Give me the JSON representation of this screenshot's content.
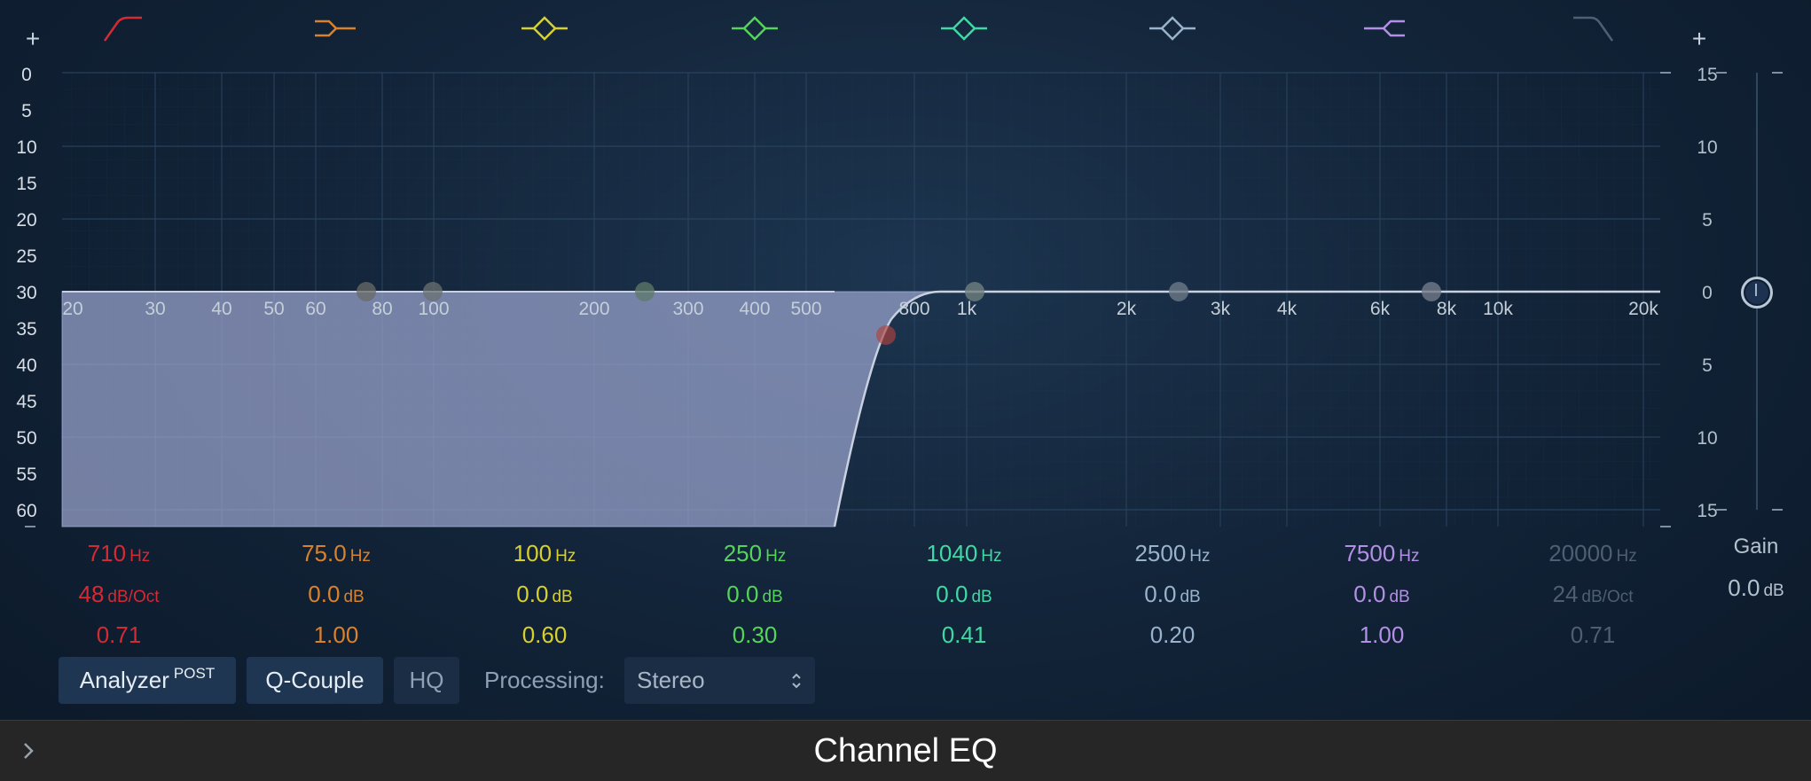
{
  "controls": {
    "add_band_left": "+",
    "add_band_right": "+"
  },
  "db_scale_left": [
    "0",
    "5",
    "10",
    "15",
    "20",
    "25",
    "30",
    "35",
    "40",
    "45",
    "50",
    "55",
    "60"
  ],
  "gain_scale_right": [
    "15",
    "10",
    "5",
    "0",
    "5",
    "10",
    "15"
  ],
  "freq_labels": [
    "20",
    "30",
    "40",
    "50",
    "60",
    "80",
    "100",
    "200",
    "300",
    "400",
    "500",
    "800",
    "1k",
    "2k",
    "3k",
    "4k",
    "6k",
    "8k",
    "10k",
    "20k"
  ],
  "band_icons": [
    "low-cut-icon",
    "low-shelf-icon",
    "bell-icon",
    "bell-icon",
    "bell-icon",
    "bell-icon",
    "high-shelf-icon",
    "high-cut-icon"
  ],
  "bands": [
    {
      "freq": "710",
      "freq_unit": "Hz",
      "gain": "48",
      "gain_unit": "dB/Oct",
      "q": "0.71",
      "color": "#d42a33"
    },
    {
      "freq": "75.0",
      "freq_unit": "Hz",
      "gain": "0.0",
      "gain_unit": "dB",
      "q": "1.00",
      "color": "#d9822b"
    },
    {
      "freq": "100",
      "freq_unit": "Hz",
      "gain": "0.0",
      "gain_unit": "dB",
      "q": "0.60",
      "color": "#d8d02c"
    },
    {
      "freq": "250",
      "freq_unit": "Hz",
      "gain": "0.0",
      "gain_unit": "dB",
      "q": "0.30",
      "color": "#55d45a"
    },
    {
      "freq": "1040",
      "freq_unit": "Hz",
      "gain": "0.0",
      "gain_unit": "dB",
      "q": "0.41",
      "color": "#3fd9a4"
    },
    {
      "freq": "2500",
      "freq_unit": "Hz",
      "gain": "0.0",
      "gain_unit": "dB",
      "q": "0.20",
      "color": "#9ab3cc"
    },
    {
      "freq": "7500",
      "freq_unit": "Hz",
      "gain": "0.0",
      "gain_unit": "dB",
      "q": "1.00",
      "color": "#b48fe6"
    },
    {
      "freq": "20000",
      "freq_unit": "Hz",
      "gain": "24",
      "gain_unit": "dB/Oct",
      "q": "0.71",
      "color": "#5a6b7c"
    }
  ],
  "gain": {
    "label": "Gain",
    "value": "0.0",
    "unit": "dB"
  },
  "toolbar": {
    "analyzer_label": "Analyzer",
    "analyzer_mode": "POST",
    "qcouple_label": "Q-Couple",
    "hq_label": "HQ",
    "processing_label": "Processing:",
    "processing_value": "Stereo"
  },
  "footer": {
    "title": "Channel EQ"
  },
  "colors": {
    "accent": "#1f3652",
    "curve_fill": "#9ba5cf",
    "background": "#13253a"
  }
}
